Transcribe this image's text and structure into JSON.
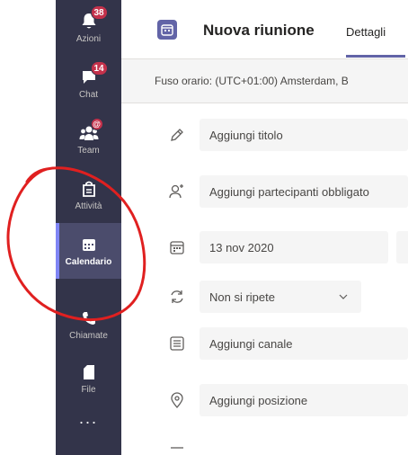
{
  "rail": {
    "items": [
      {
        "name": "rail-item-azioni",
        "label": "Azioni",
        "icon": "bell-icon",
        "badge": "38"
      },
      {
        "name": "rail-item-chat",
        "label": "Chat",
        "icon": "chat-icon",
        "badge": "14"
      },
      {
        "name": "rail-item-team",
        "label": "Team",
        "icon": "team-icon",
        "badge": "@"
      },
      {
        "name": "rail-item-attivita",
        "label": "Attività",
        "icon": "assignments-icon"
      },
      {
        "name": "rail-item-calendario",
        "label": "Calendario",
        "icon": "calendar-icon",
        "active": true
      },
      {
        "name": "rail-item-chiamate",
        "label": "Chiamate",
        "icon": "phone-icon"
      },
      {
        "name": "rail-item-file",
        "label": "File",
        "icon": "file-icon"
      }
    ],
    "more": "..."
  },
  "header": {
    "title": "Nuova riunione",
    "tab": "Dettagli",
    "icon": "calendar-icon"
  },
  "timezone": {
    "text": "Fuso orario: (UTC+01:00) Amsterdam, B"
  },
  "form": {
    "title_placeholder": "Aggiungi titolo",
    "attendees_placeholder": "Aggiungi partecipanti obbligato",
    "date": "13 nov 2020",
    "repeat": "Non si ripete",
    "channel_placeholder": "Aggiungi canale",
    "location_placeholder": "Aggiungi posizione"
  },
  "colors": {
    "rail": "#33344a",
    "accent": "#6264a7",
    "badge": "#c4314b",
    "annotation": "#e02020"
  }
}
